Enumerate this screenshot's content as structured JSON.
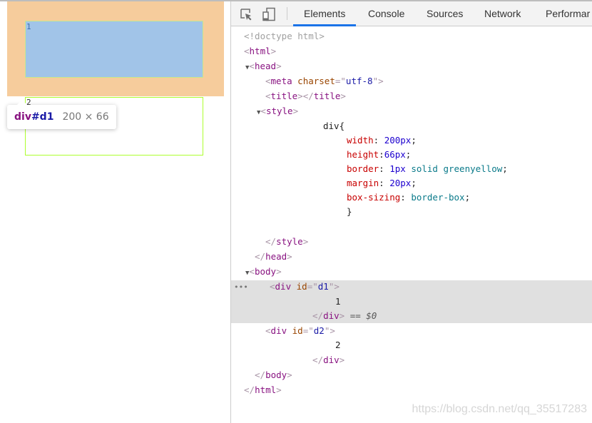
{
  "viewport": {
    "box1_text": "1",
    "box2_text": "2",
    "tooltip": {
      "tag": "div",
      "id": "#d1",
      "dimensions": "200 × 66"
    }
  },
  "devtools": {
    "toolbar": {
      "icons": [
        "inspect-element-icon",
        "device-toolbar-icon"
      ],
      "tabs": [
        {
          "label": "Elements",
          "active": true
        },
        {
          "label": "Console",
          "active": false
        },
        {
          "label": "Sources",
          "active": false
        },
        {
          "label": "Network",
          "active": false
        },
        {
          "label": "Performar",
          "active": false
        }
      ]
    },
    "dom": {
      "doctype": "<!doctype html>",
      "html_open": "html",
      "head_open": "head",
      "meta_tag": "meta",
      "meta_attr": "charset",
      "meta_val": "utf-8",
      "title_tag": "title",
      "style_tag": "style",
      "css_selector": "div{",
      "css_rules": [
        {
          "prop": "width",
          "sep": ": ",
          "value": "200px",
          "vtype": "num"
        },
        {
          "prop": "height",
          "sep": ":",
          "value": "66px",
          "vtype": "num"
        },
        {
          "prop": "border",
          "sep": ": ",
          "value": "1px",
          "vtype": "num",
          "extra": " solid greenyellow"
        },
        {
          "prop": "margin",
          "sep": ": ",
          "value": "20px",
          "vtype": "num"
        },
        {
          "prop": "box-sizing",
          "sep": ": ",
          "value": "border-box",
          "vtype": "kw"
        }
      ],
      "css_close": "}",
      "body_tag": "body",
      "div_tag": "div",
      "id_attr": "id",
      "d1_id": "d1",
      "d1_text": "1",
      "d2_id": "d2",
      "d2_text": "2",
      "selected_marker": "== $0",
      "ellipsis": "•••"
    },
    "watermark": "https://blog.csdn.net/qq_35517283"
  }
}
